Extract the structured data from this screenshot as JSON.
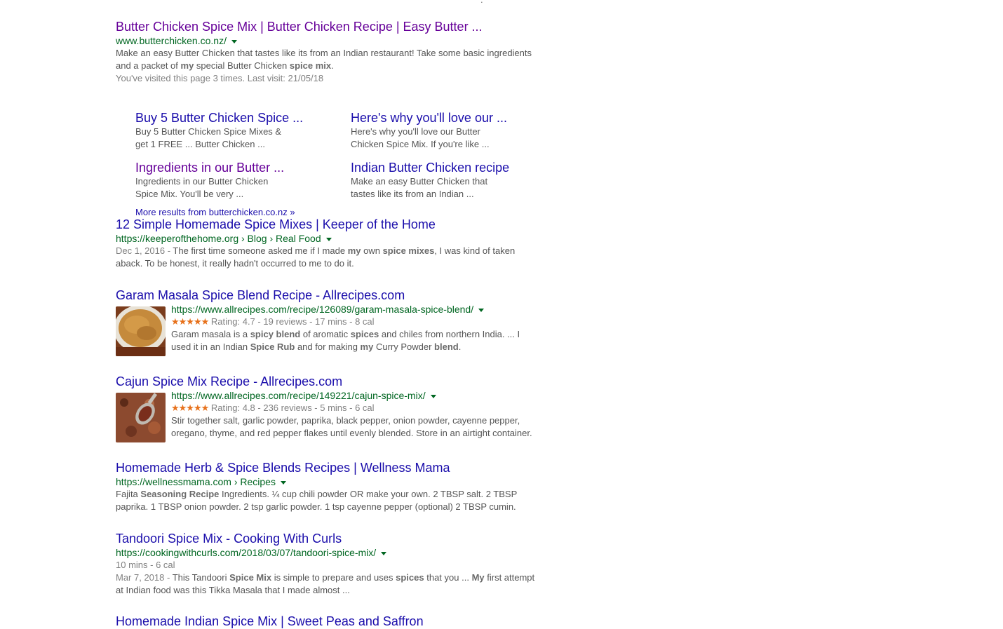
{
  "r1": {
    "title": "Butter Chicken Spice Mix | Butter Chicken Recipe | Easy Butter ...",
    "url": "www.butterchicken.co.nz/",
    "s1": "Make an easy Butter Chicken that tastes like its from an Indian restaurant! Take some basic ingredients",
    "s2a": "and a packet of ",
    "s2b": "my",
    "s2c": " special Butter Chicken ",
    "s2d": "spice mix",
    "s2e": ".",
    "visited": "You've visited this page 3 times. Last visit: 21/05/18",
    "sitelinks": [
      {
        "title": "Buy 5 Butter Chicken Spice ...",
        "d1": "Buy 5 Butter Chicken Spice Mixes &",
        "d2": "get 1 FREE ... Butter Chicken ..."
      },
      {
        "title": "Here's why you'll love our ...",
        "d1": "Here's why you'll love our Butter",
        "d2": "Chicken Spice Mix. If you're like ..."
      },
      {
        "title": "Ingredients in our Butter ...",
        "d1": "Ingredients in our Butter Chicken",
        "d2": "Spice Mix. You'll be very ..."
      },
      {
        "title": "Indian Butter Chicken recipe",
        "d1": "Make an easy Butter Chicken that",
        "d2": "tastes like its from an Indian ..."
      }
    ],
    "more": "More results from butterchicken.co.nz »"
  },
  "r2": {
    "title": "12 Simple Homemade Spice Mixes | Keeper of the Home",
    "url": "https://keeperofthehome.org › Blog › Real Food",
    "date": "Dec 1, 2016 - ",
    "s1a": "The first time someone asked me if I made ",
    "s1b": "my",
    "s1c": " own ",
    "s1d": "spice mixes",
    "s1e": ", I was kind of taken",
    "s2": "aback. To be honest, it really hadn't occurred to me to do it."
  },
  "r3": {
    "title_a": "Garam Masala Spice Blend Recipe",
    "title_b": " - ",
    "title_c": "Allrecipes.com",
    "url": "https://www.allrecipes.com/recipe/126089/garam-masala-spice-blend/",
    "stars": "★★★★★",
    "rating": "Rating: 4.7 - 19 reviews - 17 mins - 8 cal",
    "s1a": "Garam masala is a ",
    "s1b": "spicy blend",
    "s1c": " of aromatic ",
    "s1d": "spices",
    "s1e": " and chiles from northern India. ... I",
    "s2a": "used it in an Indian ",
    "s2b": "Spice Rub",
    "s2c": " and for making ",
    "s2d": "my",
    "s2e": " Curry Powder ",
    "s2f": "blend",
    "s2g": "."
  },
  "r4": {
    "title_a": "Cajun Spice Mix Recipe",
    "title_b": " - ",
    "title_c": "Allrecipes.com",
    "url": "https://www.allrecipes.com/recipe/149221/cajun-spice-mix/",
    "stars": "★★★★★",
    "rating": "Rating: 4.8 - 236 reviews - 5 mins - 6 cal",
    "s1": "Stir together salt, garlic powder, paprika, black pepper, onion powder, cayenne pepper,",
    "s2": "oregano, thyme, and red pepper flakes until evenly blended. Store in an airtight container."
  },
  "r5": {
    "title": "Homemade Herb & Spice Blends Recipes | Wellness Mama",
    "url": "https://wellnessmama.com › Recipes",
    "s1a": "Fajita ",
    "s1b": "Seasoning Recipe",
    "s1c": " Ingredients. ¼ cup chili powder OR make your own. 2 TBSP salt. 2 TBSP",
    "s2": "paprika. 1 TBSP onion powder. 2 tsp garlic powder. 1 tsp cayenne pepper (optional) 2 TBSP cumin."
  },
  "r6": {
    "title_a": "Tandoori Spice Mix",
    "title_b": " - ",
    "title_c": "Cooking With Curls",
    "url": "https://cookingwithcurls.com/2018/03/07/tandoori-spice-mix/",
    "meta": "10 mins - 6 cal",
    "date": "Mar 7, 2018 - ",
    "s1a": "This Tandoori ",
    "s1b": "Spice Mix",
    "s1c": " is simple to prepare and uses ",
    "s1d": "spices",
    "s1e": " that you ... ",
    "s1f": "My",
    "s1g": " first attempt",
    "s2": "at Indian food was this Tikka Masala that I made almost ..."
  },
  "r7": {
    "title": "Homemade Indian Spice Mix | Sweet Peas and Saffron"
  }
}
